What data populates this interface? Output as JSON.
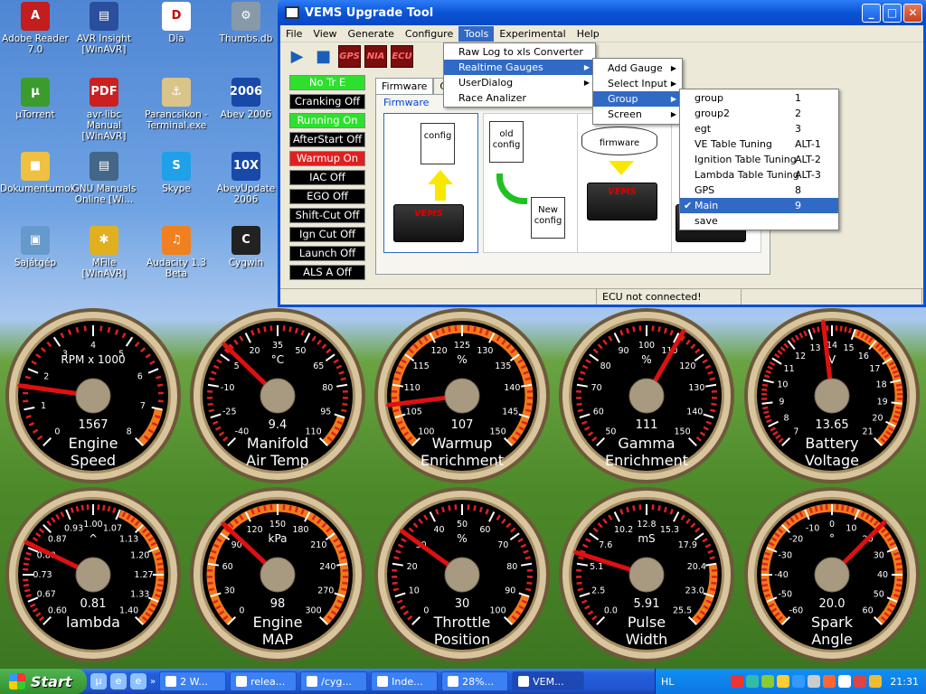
{
  "desktop_icons": [
    {
      "label": "Adobe Reader 7.0",
      "icon": "adobe-reader-icon",
      "color": "#c31d1d",
      "short": "A"
    },
    {
      "label": "AVR Insight [WinAVR]",
      "icon": "avr-insight-icon",
      "color": "#2a4f9d",
      "short": "▤"
    },
    {
      "label": "Dia",
      "icon": "dia-icon",
      "color": "#ffffff",
      "short": "D"
    },
    {
      "label": "Thumbs.db",
      "icon": "thumbs-db-icon",
      "color": "#8899aa",
      "short": "⚙"
    },
    {
      "label": "µTorrent",
      "icon": "utorrent-icon",
      "color": "#3c9b2e",
      "short": "µ"
    },
    {
      "label": "avr-libc Manual [WinAVR]",
      "icon": "pdf-icon",
      "color": "#cc1f1f",
      "short": "PDF"
    },
    {
      "label": "Parancsikon - Terminal.exe",
      "icon": "terminal-icon",
      "color": "#d9c48a",
      "short": "⚓"
    },
    {
      "label": "Abev 2006",
      "icon": "abev-icon",
      "color": "#1848a8",
      "short": "2006"
    },
    {
      "label": "Dokumentumok",
      "icon": "folder-icon",
      "color": "#f0c040",
      "short": "■"
    },
    {
      "label": "GNU Manuals Online [Wi...",
      "icon": "gnu-icon",
      "color": "#446688",
      "short": "▤"
    },
    {
      "label": "Skype",
      "icon": "skype-icon",
      "color": "#1fa0e8",
      "short": "S"
    },
    {
      "label": "AbevUpdate 2006",
      "icon": "abevupdate-icon",
      "color": "#1848a8",
      "short": "10X"
    },
    {
      "label": "Sajátgép",
      "icon": "my-computer-icon",
      "color": "#6699cc",
      "short": "▣"
    },
    {
      "label": "MFile [WinAVR]",
      "icon": "mfile-icon",
      "color": "#e0b020",
      "short": "✱"
    },
    {
      "label": "Audacity 1.3 Beta",
      "icon": "audacity-icon",
      "color": "#f08020",
      "short": "♫"
    },
    {
      "label": "Cygwin",
      "icon": "cygwin-icon",
      "color": "#222222",
      "short": "C"
    }
  ],
  "window": {
    "title": "VEMS Upgrade Tool",
    "minimize": "_",
    "maximize": "□",
    "close": "✕",
    "menus": [
      "File",
      "View",
      "Generate",
      "Configure",
      "Tools",
      "Experimental",
      "Help"
    ],
    "active_menu": "Tools",
    "toolbar": [
      {
        "icon": "play-icon",
        "label": "▶"
      },
      {
        "icon": "stop-icon",
        "label": "■"
      },
      {
        "icon": "gps-icon",
        "label": "GPS"
      },
      {
        "icon": "nia-icon",
        "label": "NIA"
      },
      {
        "icon": "ecu-icon",
        "label": "ECU"
      }
    ],
    "flags": [
      {
        "label": "No Tr E",
        "state": "green"
      },
      {
        "label": "Cranking Off",
        "state": "black"
      },
      {
        "label": "Running On",
        "state": "green"
      },
      {
        "label": "AfterStart Off",
        "state": "black"
      },
      {
        "label": "Warmup On",
        "state": "red"
      },
      {
        "label": "IAC Off",
        "state": "black"
      },
      {
        "label": "EGO Off",
        "state": "black"
      },
      {
        "label": "Shift-Cut Off",
        "state": "black"
      },
      {
        "label": "Ign Cut Off",
        "state": "black"
      },
      {
        "label": "Launch Off",
        "state": "black"
      },
      {
        "label": "ALS A Off",
        "state": "black"
      }
    ],
    "tabs": [
      "Firmware",
      "Co"
    ],
    "group_label": "Firmware",
    "fw_items": {
      "config": "config",
      "old_config": "old config",
      "new_config": "New config",
      "firmware": "firmware"
    },
    "status_cells": [
      "",
      "ECU not connected!",
      ""
    ]
  },
  "menus": {
    "tools": [
      {
        "label": "Raw Log to xls Converter",
        "submenu": false
      },
      {
        "label": "Realtime Gauges",
        "submenu": true,
        "highlighted": true
      },
      {
        "label": "UserDialog",
        "submenu": true
      },
      {
        "label": "Race Analizer",
        "submenu": false
      }
    ],
    "realtime_gauges": [
      {
        "label": "Add Gauge",
        "submenu": true
      },
      {
        "label": "Select Input",
        "submenu": true
      },
      {
        "label": "Group",
        "submenu": true,
        "highlighted": true
      },
      {
        "label": "Screen",
        "submenu": true
      }
    ],
    "group": [
      {
        "label": "group",
        "acc": "1"
      },
      {
        "label": "group2",
        "acc": "2"
      },
      {
        "label": "egt",
        "acc": "3"
      },
      {
        "label": "VE Table Tuning",
        "acc": "ALT-1"
      },
      {
        "label": "Ignition Table Tuning",
        "acc": "ALT-2"
      },
      {
        "label": "Lambda Table Tuning",
        "acc": "ALT-3"
      },
      {
        "label": "GPS",
        "acc": "8"
      },
      {
        "label": "Main",
        "acc": "9",
        "checked": true,
        "highlighted": true
      },
      {
        "label": "save",
        "acc": ""
      }
    ],
    "arrow": "▶",
    "check": "✔"
  },
  "gauges": [
    {
      "name": "engine-speed",
      "unit": "RPM x 1000",
      "title1": "Engine",
      "title2": "Speed",
      "value": "1567",
      "v": 1.567,
      "min": 0,
      "max": 8,
      "ticks": [
        "0",
        "1",
        "2",
        "3",
        "4",
        "5",
        "6",
        "7",
        "8"
      ],
      "warn_from": 7,
      "warn_to": 8
    },
    {
      "name": "manifold-air-temp",
      "unit": "°C",
      "title1": "Manifold",
      "title2": "Air Temp",
      "value": "9.4",
      "v": 9.4,
      "min": -40,
      "max": 110,
      "ticks": [
        "-40",
        "-25",
        "-10",
        "5",
        "20",
        "35",
        "50",
        "65",
        "80",
        "95",
        "110"
      ],
      "warn_from": 95,
      "warn_to": 110
    },
    {
      "name": "warmup-enrichment",
      "unit": "%",
      "title1": "Warmup",
      "title2": "Enrichment",
      "value": "107",
      "v": 107,
      "min": 100,
      "max": 150,
      "ticks": [
        "100",
        "105",
        "110",
        "115",
        "120",
        "125",
        "130",
        "135",
        "140",
        "145",
        "150"
      ],
      "warn_from": 100,
      "warn_to": 150
    },
    {
      "name": "gamma-enrichment",
      "unit": "%",
      "title1": "Gamma",
      "title2": "Enrichment",
      "value": "111",
      "v": 111,
      "min": 50,
      "max": 150,
      "ticks": [
        "50",
        "60",
        "70",
        "80",
        "90",
        "100",
        "110",
        "120",
        "130",
        "140",
        "150"
      ],
      "warn_from": 150,
      "warn_to": 150
    },
    {
      "name": "battery-voltage",
      "unit": "V",
      "title1": "Battery",
      "title2": "Voltage",
      "value": "13.65",
      "v": 13.65,
      "min": 7,
      "max": 21,
      "ticks": [
        "7",
        "8",
        "9",
        "10",
        "11",
        "12",
        "13",
        "14",
        "15",
        "16",
        "17",
        "18",
        "19",
        "20",
        "21"
      ],
      "warn_from": 15,
      "warn_to": 21
    },
    {
      "name": "lambda",
      "unit": "^",
      "title1": "lambda",
      "title2": "",
      "value": "0.81",
      "v": 0.81,
      "min": 0.6,
      "max": 1.4,
      "ticks": [
        "0.60",
        "0.67",
        "0.73",
        "0.80",
        "0.87",
        "0.93",
        "1.00",
        "1.07",
        "1.13",
        "1.20",
        "1.27",
        "1.33",
        "1.40"
      ],
      "warn_from": 1.07,
      "warn_to": 1.4
    },
    {
      "name": "engine-map",
      "unit": "kPa",
      "title1": "Engine",
      "title2": "MAP",
      "value": "98",
      "v": 98,
      "min": 0,
      "max": 300,
      "ticks": [
        "0",
        "30",
        "60",
        "90",
        "120",
        "150",
        "180",
        "210",
        "240",
        "270",
        "300"
      ],
      "warn_from": 0,
      "warn_to": 300
    },
    {
      "name": "throttle-position",
      "unit": "%",
      "title1": "Throttle",
      "title2": "Position",
      "value": "30",
      "v": 30,
      "min": 0,
      "max": 100,
      "ticks": [
        "0",
        "10",
        "20",
        "30",
        "40",
        "50",
        "60",
        "70",
        "80",
        "90",
        "100"
      ],
      "warn_from": 90,
      "warn_to": 100
    },
    {
      "name": "pulse-width",
      "unit": "mS",
      "title1": "Pulse",
      "title2": "Width",
      "value": "5.91",
      "v": 5.91,
      "min": 0,
      "max": 25.5,
      "ticks": [
        "0.0",
        "2.5",
        "5.1",
        "7.6",
        "10.2",
        "12.8",
        "15.3",
        "17.9",
        "20.4",
        "23.0",
        "25.5"
      ],
      "warn_from": 20.4,
      "warn_to": 25.5
    },
    {
      "name": "spark-angle",
      "unit": "°",
      "title1": "Spark",
      "title2": "Angle",
      "value": "20.0",
      "v": 20,
      "min": -60,
      "max": 60,
      "ticks": [
        "-60",
        "-50",
        "-40",
        "-30",
        "-20",
        "-10",
        "0",
        "10",
        "20",
        "30",
        "40",
        "50",
        "60"
      ],
      "warn_from": -60,
      "warn_to": 60
    }
  ],
  "taskbar": {
    "start": "Start",
    "tasks": [
      {
        "label": "2 W...",
        "icon": "folder-icon"
      },
      {
        "label": "relea...",
        "icon": "document-icon"
      },
      {
        "label": "/cyg...",
        "icon": "cygwin-icon"
      },
      {
        "label": "Inde...",
        "icon": "ie-icon"
      },
      {
        "label": "28%...",
        "icon": "utorrent-icon"
      },
      {
        "label": "VEM...",
        "icon": "vems-icon",
        "active": true
      }
    ],
    "lang": "HL",
    "clock": "21:31"
  }
}
